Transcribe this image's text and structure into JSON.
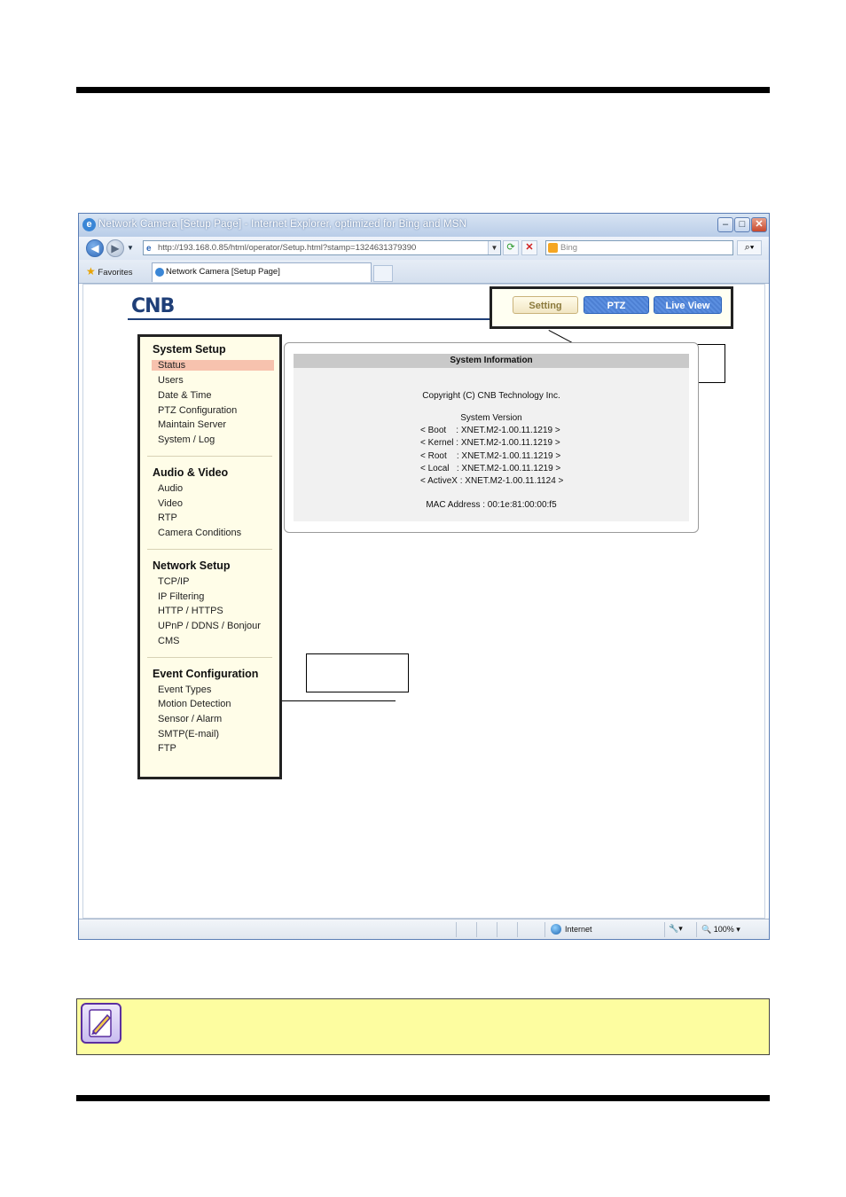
{
  "browser": {
    "title": "Network Camera [Setup Page] - Internet Explorer, optimized for Bing and MSN",
    "url": "http://193.168.0.85/html/operator/Setup.html?stamp=1324631379390",
    "search_placeholder": "Bing",
    "favorites_label": "Favorites",
    "tab_label": "Network Camera [Setup Page]",
    "status_zone": "Internet",
    "zoom": "100%"
  },
  "header": {
    "logo": "CNB",
    "menu": {
      "setting": "Setting",
      "ptz": "PTZ",
      "live_view": "Live View"
    }
  },
  "sidebar": {
    "sections": [
      {
        "title": "System Setup",
        "items": [
          "Status",
          "Users",
          "Date & Time",
          "PTZ Configuration",
          "Maintain Server",
          "System / Log"
        ]
      },
      {
        "title": "Audio & Video",
        "items": [
          "Audio",
          "Video",
          "RTP",
          "Camera Conditions"
        ]
      },
      {
        "title": "Network Setup",
        "items": [
          "TCP/IP",
          "IP Filtering",
          "HTTP / HTTPS",
          "UPnP / DDNS / Bonjour",
          "CMS"
        ]
      },
      {
        "title": "Event Configuration",
        "items": [
          "Event Types",
          "Motion Detection",
          "Sensor / Alarm",
          "SMTP(E-mail)",
          "FTP"
        ]
      }
    ]
  },
  "system_info": {
    "heading": "System Information",
    "copyright": "Copyright (C) CNB Technology Inc.",
    "version_label": "System Version",
    "versions": [
      "< Boot    : XNET.M2-1.00.11.1219 >",
      "< Kernel : XNET.M2-1.00.11.1219 >",
      "< Root    : XNET.M2-1.00.11.1219 >",
      "< Local   : XNET.M2-1.00.11.1219 >",
      "< ActiveX : XNET.M2-1.00.11.1124 >"
    ],
    "mac": "MAC Address : 00:1e:81:00:00:f5"
  },
  "colors": {
    "brand": "#1f3f78",
    "sidebar_bg": "#fffde8",
    "active_item": "#f7c2ae",
    "note_bg": "#fdfda0"
  }
}
